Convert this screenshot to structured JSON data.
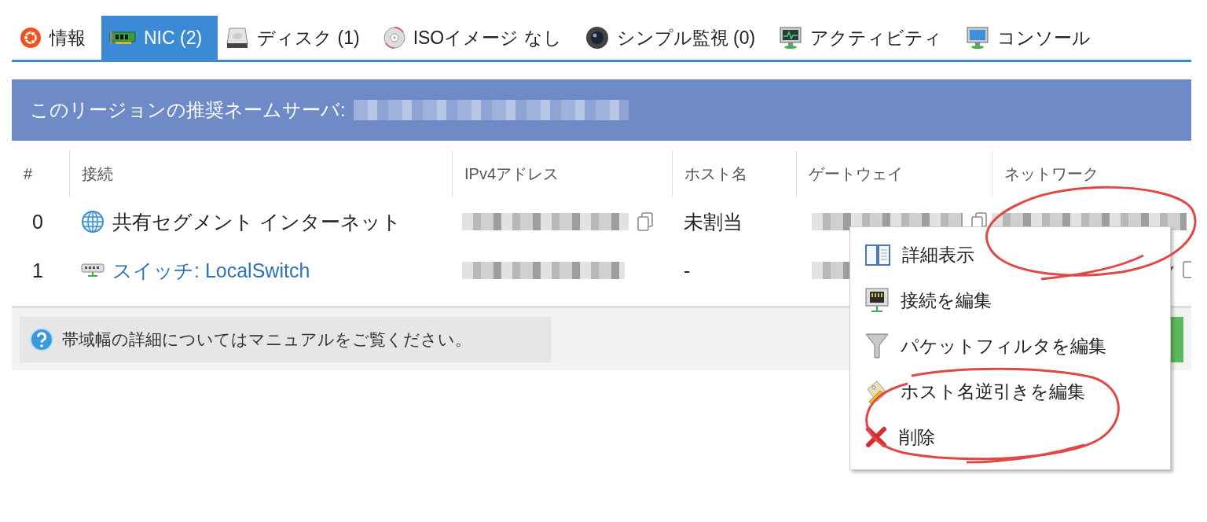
{
  "tabs": [
    {
      "label": "情報",
      "kind": "info",
      "selected": false
    },
    {
      "label": "NIC (2)",
      "kind": "nic",
      "selected": true
    },
    {
      "label": "ディスク (1)",
      "kind": "disk",
      "selected": false
    },
    {
      "label": "ISOイメージ なし",
      "kind": "iso",
      "selected": false
    },
    {
      "label": "シンプル監視 (0)",
      "kind": "monitor",
      "selected": false
    },
    {
      "label": "アクティビティ",
      "kind": "activity",
      "selected": false
    },
    {
      "label": "コンソール",
      "kind": "console",
      "selected": false
    }
  ],
  "banner": {
    "label": "このリージョンの推奨ネームサーバ:"
  },
  "table": {
    "columns": [
      "#",
      "接続",
      "IPv4アドレス",
      "ホスト名",
      "ゲートウェイ",
      "ネットワーク"
    ],
    "rows": [
      {
        "index": "0",
        "kind": "internet",
        "connection": "共有セグメント インターネット",
        "hostname": "未割当"
      },
      {
        "index": "1",
        "kind": "switch",
        "connection": "スイッチ: LocalSwitch",
        "hostname": "-"
      }
    ]
  },
  "note": "帯域幅の詳細についてはマニュアルをご覧ください。",
  "context_menu": {
    "items": [
      {
        "label": "詳細表示",
        "kind": "details"
      },
      {
        "label": "接続を編集",
        "kind": "connection"
      },
      {
        "label": "パケットフィルタを編集",
        "kind": "filter"
      },
      {
        "label": "ホスト名逆引きを編集",
        "kind": "reverse"
      },
      {
        "label": "削除",
        "kind": "delete"
      }
    ]
  }
}
